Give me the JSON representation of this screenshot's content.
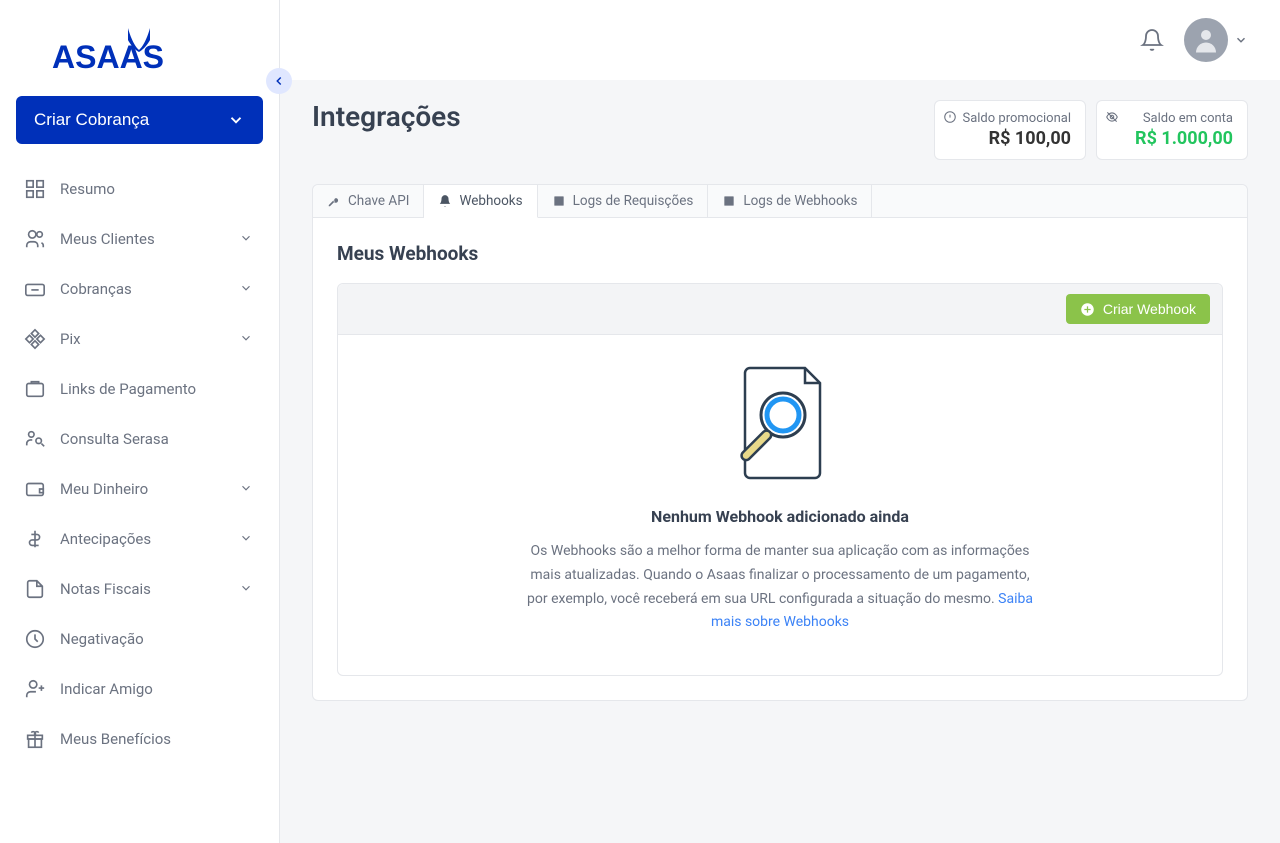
{
  "brand": "ASAAS",
  "primary_button": {
    "label": "Criar Cobrança"
  },
  "sidebar": {
    "items": [
      {
        "label": "Resumo",
        "icon": "dashboard",
        "chevron": false
      },
      {
        "label": "Meus Clientes",
        "icon": "users",
        "chevron": true
      },
      {
        "label": "Cobranças",
        "icon": "billing",
        "chevron": true
      },
      {
        "label": "Pix",
        "icon": "pix",
        "chevron": true
      },
      {
        "label": "Links de Pagamento",
        "icon": "link",
        "chevron": false
      },
      {
        "label": "Consulta Serasa",
        "icon": "search-person",
        "chevron": false
      },
      {
        "label": "Meu Dinheiro",
        "icon": "wallet",
        "chevron": true
      },
      {
        "label": "Antecipações",
        "icon": "money",
        "chevron": true
      },
      {
        "label": "Notas Fiscais",
        "icon": "invoice",
        "chevron": true
      },
      {
        "label": "Negativação",
        "icon": "negative",
        "chevron": false
      },
      {
        "label": "Indicar Amigo",
        "icon": "add-user",
        "chevron": false
      },
      {
        "label": "Meus Benefícios",
        "icon": "gift",
        "chevron": false
      }
    ]
  },
  "page": {
    "title": "Integrações"
  },
  "balances": [
    {
      "label": "Saldo promocional",
      "value": "R$ 100,00",
      "green": false,
      "icon": "info"
    },
    {
      "label": "Saldo em conta",
      "value": "R$ 1.000,00",
      "green": true,
      "icon": "eye-off"
    }
  ],
  "tabs": [
    {
      "label": "Chave API",
      "icon": "key",
      "active": false
    },
    {
      "label": "Webhooks",
      "icon": "bell",
      "active": true
    },
    {
      "label": "Logs de Requisções",
      "icon": "list",
      "active": false
    },
    {
      "label": "Logs de Webhooks",
      "icon": "list",
      "active": false
    }
  ],
  "section": {
    "title": "Meus Webhooks",
    "create_label": "Criar Webhook",
    "empty_title": "Nenhum Webhook adicionado ainda",
    "empty_desc": "Os Webhooks são a melhor forma de manter sua aplicação com as informações mais atualizadas. Quando o Asaas finalizar o processamento de um pagamento, por exemplo, você receberá em sua URL configurada a situação do mesmo. ",
    "empty_link": "Saiba mais sobre Webhooks"
  }
}
